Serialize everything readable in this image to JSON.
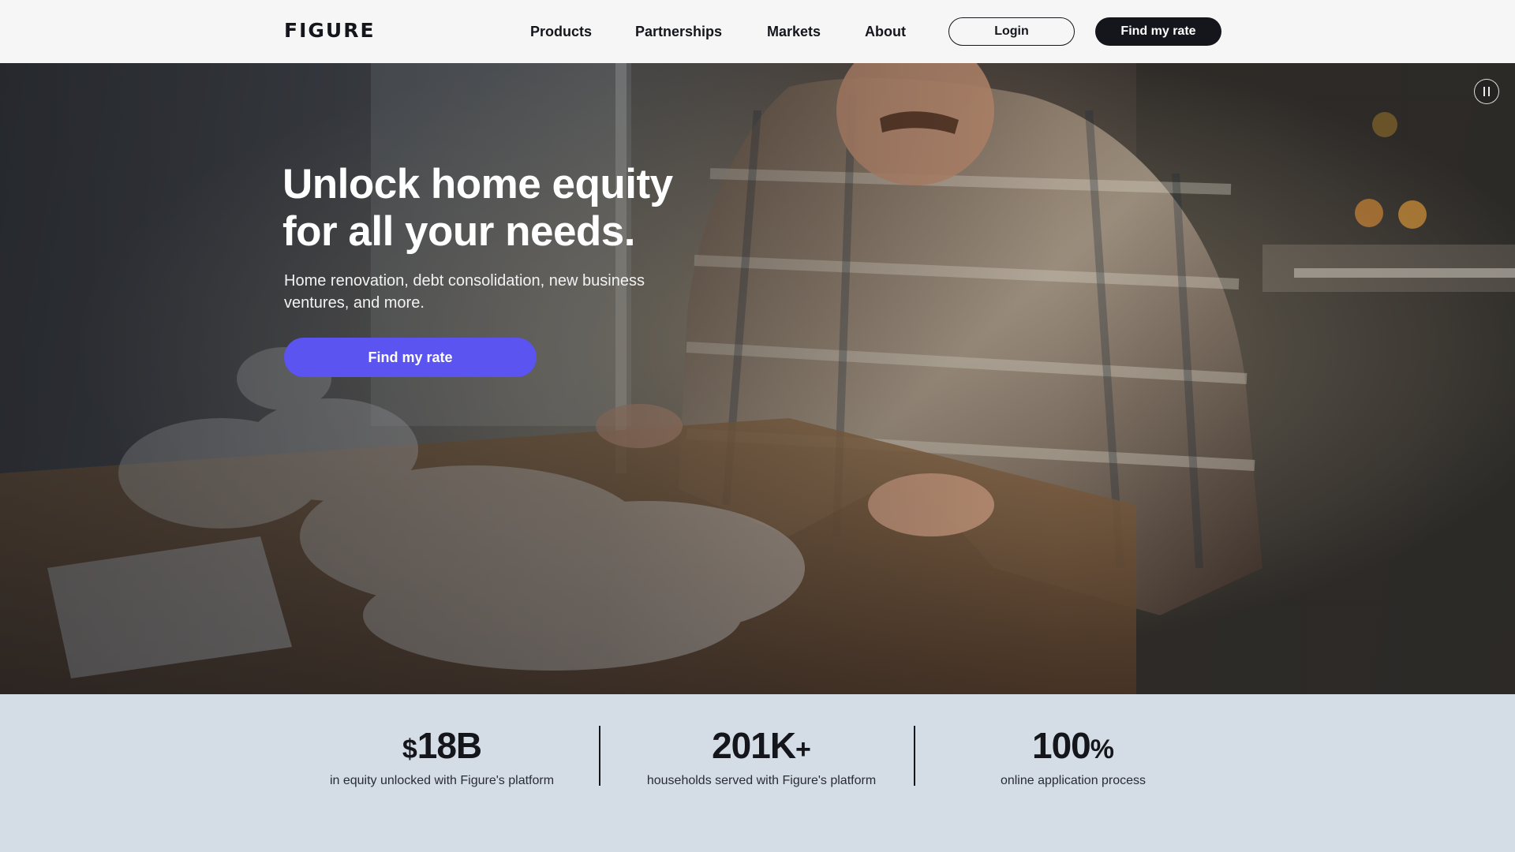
{
  "header": {
    "logo": "FIGURE",
    "nav": [
      {
        "label": "Products"
      },
      {
        "label": "Partnerships"
      },
      {
        "label": "Markets"
      },
      {
        "label": "About"
      }
    ],
    "login_label": "Login",
    "cta_label": "Find my rate"
  },
  "hero": {
    "headline_line1": "Unlock home equity",
    "headline_line2": "for all your needs.",
    "subhead": "Home renovation, debt consolidation, new business ventures, and more.",
    "cta_label": "Find my rate",
    "video_control": "pause-icon"
  },
  "stats": [
    {
      "prefix": "$",
      "value": "18B",
      "suffix": "",
      "caption": "in equity unlocked with Figure's platform"
    },
    {
      "prefix": "",
      "value": "201K",
      "suffix": "+",
      "caption": "households served with Figure's platform"
    },
    {
      "prefix": "",
      "value": "100",
      "suffix": "%",
      "caption": "online application process"
    }
  ],
  "colors": {
    "brand_dark": "#15161c",
    "hero_cta": "#5b54f0",
    "stats_bg": "#d4dde6",
    "header_bg": "#f6f6f6"
  }
}
